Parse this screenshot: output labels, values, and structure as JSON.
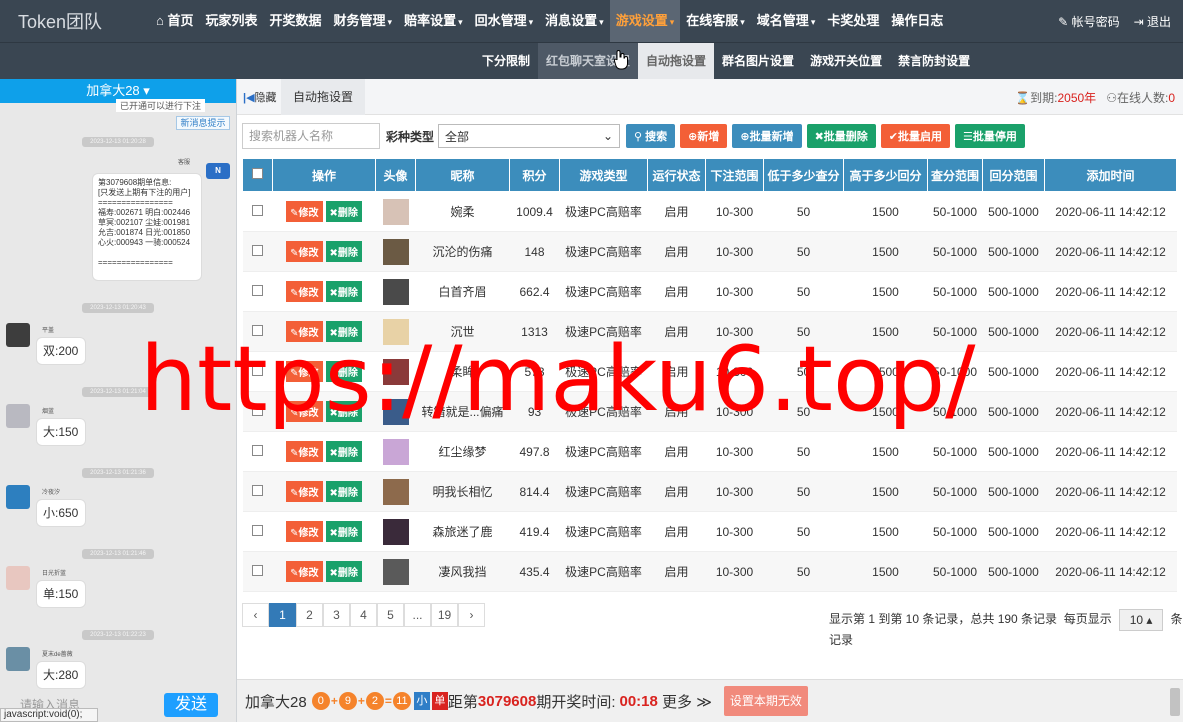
{
  "brand": "Token团队",
  "nav": {
    "items": [
      {
        "label": "首页",
        "icon": "home-icon"
      },
      {
        "label": "玩家列表"
      },
      {
        "label": "开奖数据"
      },
      {
        "label": "财务管理",
        "caret": "▾"
      },
      {
        "label": "赔率设置",
        "caret": "▾"
      },
      {
        "label": "回水管理",
        "caret": "▾"
      },
      {
        "label": "消息设置",
        "caret": "▾"
      },
      {
        "label": "游戏设置",
        "caret": "▾",
        "active": true
      },
      {
        "label": "在线客服",
        "caret": "▾"
      },
      {
        "label": "域名管理",
        "caret": "▾"
      },
      {
        "label": "卡奖处理"
      },
      {
        "label": "操作日志"
      }
    ],
    "account_label": "帐号密码",
    "logout_label": "退出"
  },
  "subnav": {
    "items": [
      "下分限制",
      "红包聊天室设置",
      "自动拖设置",
      "群名图片设置",
      "游戏开关位置",
      "禁言防封设置"
    ],
    "current_index": 2,
    "hover_index": 1
  },
  "chat": {
    "room": "加拿大28 ▾",
    "notify_label": "新消息提示",
    "cut_top_text": "已开通可以进行下注",
    "timestamps": [
      "2023-12-13 01:20:28",
      "2023-12-13 01:20:43",
      "2023-12-13 01:21:04",
      "2023-12-13 01:21:36",
      "2023-12-13 01:21:46",
      "2023-12-13 01:22:23"
    ],
    "bill_sender": "客服",
    "bill_lines": [
      "第3079608期单信息:",
      "[只发送上期有下注的用户]",
      "================",
      "福寿:002671 明白:002446",
      "草冥:002107 尘娃:001981",
      "允吉:001874 日光:001850",
      "心火:000943 一骑:000524",
      "",
      "================"
    ],
    "messages": [
      {
        "user": "平盖",
        "text": "双:200",
        "avatar_color": "#3d3d3d"
      },
      {
        "user": "烟蓝",
        "text": "大:150",
        "avatar_color": "#b9b9c1"
      },
      {
        "user": "冷夜汐",
        "text": "小:650",
        "avatar_color": "#2d7fbf"
      },
      {
        "user": "日光折蓝",
        "text": "单:150",
        "avatar_color": "#e8c7c0"
      },
      {
        "user": "夏末de蔷薇",
        "text": "大:280",
        "avatar_color": "#6a8fa5"
      }
    ],
    "input_placeholder": "请输入消息",
    "send_label": "发送",
    "status_url": "javascript:void(0);"
  },
  "main": {
    "hide_label": "隐藏",
    "tab_label": "自动拖设置",
    "expire_label": "到期:",
    "expire_value": "2050年",
    "online_label": "在线人数:",
    "online_value": "0",
    "search_placeholder": "搜索机器人名称",
    "lottery_type_label": "彩种类型",
    "lottery_type_value": "全部",
    "buttons": {
      "search": "搜索",
      "add": "新增",
      "batch_add": "批量新增",
      "batch_delete": "批量删除",
      "batch_enable": "批量启用",
      "batch_disable": "批量停用"
    },
    "colors": {
      "search": "#3c8dbc",
      "add": "#f35f37",
      "batch_add": "#3c8dbc",
      "batch_delete": "#1aa16a",
      "batch_enable": "#f35f37",
      "batch_disable": "#1aa16a"
    },
    "table": {
      "headers": [
        "",
        "操作",
        "头像",
        "昵称",
        "积分",
        "游戏类型",
        "运行状态",
        "下注范围",
        "低于多少查分",
        "高于多少回分",
        "查分范围",
        "回分范围",
        "添加时间"
      ],
      "edit_label": "修改",
      "delete_label": "删除",
      "rows": [
        {
          "name": "婉柔",
          "points": "1009.4",
          "type": "极速PC高赔率",
          "status": "启用",
          "bet": "10-300",
          "low": "50",
          "high": "1500",
          "check": "50-1000",
          "return": "500-1000",
          "time": "2020-06-11 14:42:12",
          "av": "#d7c2b6"
        },
        {
          "name": "沉沦的伤痛",
          "points": "148",
          "type": "极速PC高赔率",
          "status": "启用",
          "bet": "10-300",
          "low": "50",
          "high": "1500",
          "check": "50-1000",
          "return": "500-1000",
          "time": "2020-06-11 14:42:12",
          "av": "#6b5a44"
        },
        {
          "name": "白首齐眉",
          "points": "662.4",
          "type": "极速PC高赔率",
          "status": "启用",
          "bet": "10-300",
          "low": "50",
          "high": "1500",
          "check": "50-1000",
          "return": "500-1000",
          "time": "2020-06-11 14:42:12",
          "av": "#4a4a4a"
        },
        {
          "name": "沉世",
          "points": "1313",
          "type": "极速PC高赔率",
          "status": "启用",
          "bet": "10-300",
          "low": "50",
          "high": "1500",
          "check": "50-1000",
          "return": "500-1000",
          "time": "2020-06-11 14:42:12",
          "av": "#e8d2a6"
        },
        {
          "name": "柔眸",
          "points": "573",
          "type": "极速PC高赔率",
          "status": "启用",
          "bet": "10-300",
          "low": "50",
          "high": "1500",
          "check": "50-1000",
          "return": "500-1000",
          "time": "2020-06-11 14:42:12",
          "av": "#8a3a3a"
        },
        {
          "name": "转错就是...偏痛",
          "points": "93",
          "type": "极速PC高赔率",
          "status": "启用",
          "bet": "10-300",
          "low": "50",
          "high": "1500",
          "check": "50-1000",
          "return": "500-1000",
          "time": "2020-06-11 14:42:12",
          "av": "#3a5c8a"
        },
        {
          "name": "红尘缘梦",
          "points": "497.8",
          "type": "极速PC高赔率",
          "status": "启用",
          "bet": "10-300",
          "low": "50",
          "high": "1500",
          "check": "50-1000",
          "return": "500-1000",
          "time": "2020-06-11 14:42:12",
          "av": "#c9a6d6"
        },
        {
          "name": "明我长相忆",
          "points": "814.4",
          "type": "极速PC高赔率",
          "status": "启用",
          "bet": "10-300",
          "low": "50",
          "high": "1500",
          "check": "50-1000",
          "return": "500-1000",
          "time": "2020-06-11 14:42:12",
          "av": "#8d6a4c"
        },
        {
          "name": "森旅迷了鹿",
          "points": "419.4",
          "type": "极速PC高赔率",
          "status": "启用",
          "bet": "10-300",
          "low": "50",
          "high": "1500",
          "check": "50-1000",
          "return": "500-1000",
          "time": "2020-06-11 14:42:12",
          "av": "#3a2a3a"
        },
        {
          "name": "凄风我挡",
          "points": "435.4",
          "type": "极速PC高赔率",
          "status": "启用",
          "bet": "10-300",
          "low": "50",
          "high": "1500",
          "check": "50-1000",
          "return": "500-1000",
          "time": "2020-06-11 14:42:12",
          "av": "#5a5a5a"
        }
      ]
    },
    "pager": {
      "pages": [
        "‹",
        "1",
        "2",
        "3",
        "4",
        "5",
        "...",
        "19",
        "›"
      ],
      "current": "1",
      "summary": "显示第 1 到第 10 条记录，总共 190 条记录",
      "per_page_label": "每页显示",
      "per_page_value": "10 ▴",
      "per_page_suffix": "条记录"
    },
    "bottom": {
      "game": "加拿大28",
      "balls": [
        "0",
        "9",
        "2",
        "11"
      ],
      "size_tag": "小",
      "odd_tag": "单",
      "issue_prefix": "距第",
      "issue": "3079608",
      "issue_suffix": "期开奖时间:",
      "countdown": "00:18",
      "more_label": "更多 ≫",
      "reset_label": "设置本期无效"
    }
  },
  "watermark": "https://maku6.top/"
}
